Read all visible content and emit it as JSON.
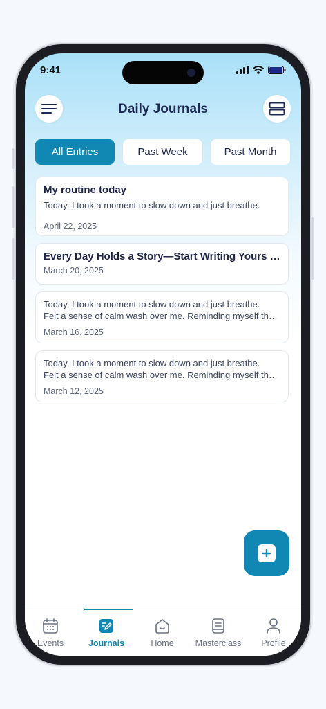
{
  "status": {
    "time": "9:41"
  },
  "header": {
    "title": "Daily Journals"
  },
  "tabs": [
    {
      "label": "All Entries",
      "active": true
    },
    {
      "label": "Past Week",
      "active": false
    },
    {
      "label": "Past Month",
      "active": false
    }
  ],
  "entries": [
    {
      "title": "My routine today",
      "body": [
        "Today, I took a moment to slow down and just breathe."
      ],
      "date": "April 22, 2025"
    },
    {
      "title": "Every Day Holds a Story—Start Writing Yours O...",
      "body": [],
      "date": "March 20, 2025"
    },
    {
      "title": "",
      "body": [
        "Today, I took a moment to slow down and just breathe.",
        "Felt a sense of calm wash over me. Reminding myself tha..."
      ],
      "date": "March 16, 2025"
    },
    {
      "title": "",
      "body": [
        "Today, I took a moment to slow down and just breathe.",
        "Felt a sense of calm wash over me. Reminding myself tha..."
      ],
      "date": "March 12, 2025"
    }
  ],
  "nav": [
    {
      "label": "Events",
      "icon": "calendar-icon",
      "active": false
    },
    {
      "label": "Journals",
      "icon": "journal-edit-icon",
      "active": true
    },
    {
      "label": "Home",
      "icon": "home-icon",
      "active": false
    },
    {
      "label": "Masterclass",
      "icon": "book-icon",
      "active": false
    },
    {
      "label": "Profile",
      "icon": "profile-icon",
      "active": false
    }
  ],
  "colors": {
    "accent": "#1188b4",
    "title": "#1d2a55"
  }
}
